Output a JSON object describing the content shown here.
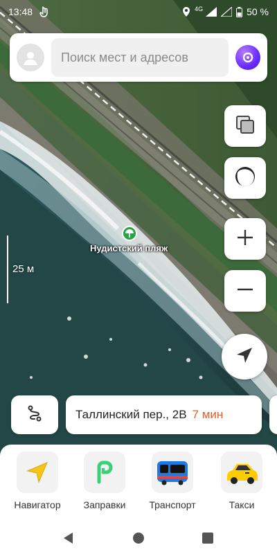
{
  "status_bar": {
    "time": "13:48",
    "network": "4G",
    "battery": "50 %",
    "icons": [
      "gesture-icon",
      "location-icon",
      "signal-icon",
      "battery-icon"
    ]
  },
  "search": {
    "placeholder": "Поиск мест и адресов",
    "avatar_icon": "user-avatar-icon",
    "assistant_icon": "alice-assistant-icon"
  },
  "map": {
    "scale_label": "25 м",
    "poi": {
      "label": "Нудистский пляж",
      "icon": "beach-umbrella-icon",
      "color": "#27a541"
    }
  },
  "controls": {
    "layers_icon": "layers-icon",
    "mode_icon": "map-mode-icon",
    "zoom_in_icon": "plus-icon",
    "zoom_out_icon": "minus-icon",
    "locate_icon": "navigation-arrow-icon"
  },
  "route": {
    "route_icon": "route-icon",
    "address": "Таллинский пер., 2В",
    "eta": "7 мин",
    "eta_color": "#f05a1a"
  },
  "services": [
    {
      "label": "Навигатор",
      "icon": "navigator-icon"
    },
    {
      "label": "Заправки",
      "icon": "fuel-app-icon"
    },
    {
      "label": "Транспорт",
      "icon": "bus-icon"
    },
    {
      "label": "Такси",
      "icon": "taxi-car-icon"
    }
  ],
  "system_nav": [
    "back-icon",
    "home-icon",
    "recents-icon"
  ]
}
